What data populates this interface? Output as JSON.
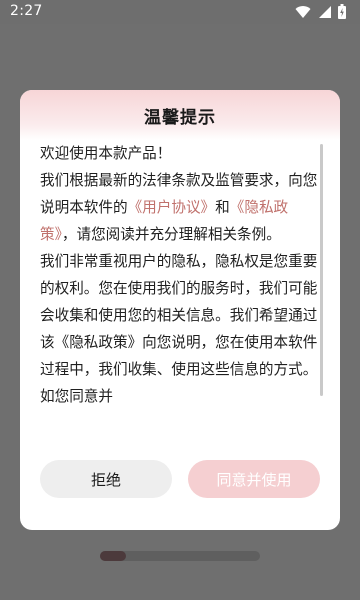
{
  "status_bar": {
    "time": "2:27"
  },
  "dialog": {
    "title": "温馨提示",
    "intro": "欢迎使用本款产品！",
    "para1_before": "我们根据最新的法律条款及监管要求，向您说明本软件的",
    "user_agreement_link": "《用户协议》",
    "para1_and": "和",
    "privacy_policy_link": "《隐私政策》",
    "para1_after": "，请您阅读并充分理解相关条例。",
    "para2": "我们非常重视用户的隐私，隐私权是您重要的权利。您在使用我们的服务时，我们可能会收集和使用您的相关信息。我们希望通过该《隐私政策》向您说明，您在使用本软件过程中，我们收集、使用这些信息的方式。如您同意并",
    "decline_label": "拒绝",
    "accept_label": "同意并使用"
  },
  "colors": {
    "link": "#c0716c",
    "accept_button": "#f5cfd1",
    "decline_button": "#eeeeee",
    "header_gradient_top": "#f7d5d7"
  },
  "icons": [
    "wifi-icon",
    "signal-icon",
    "battery-icon"
  ]
}
